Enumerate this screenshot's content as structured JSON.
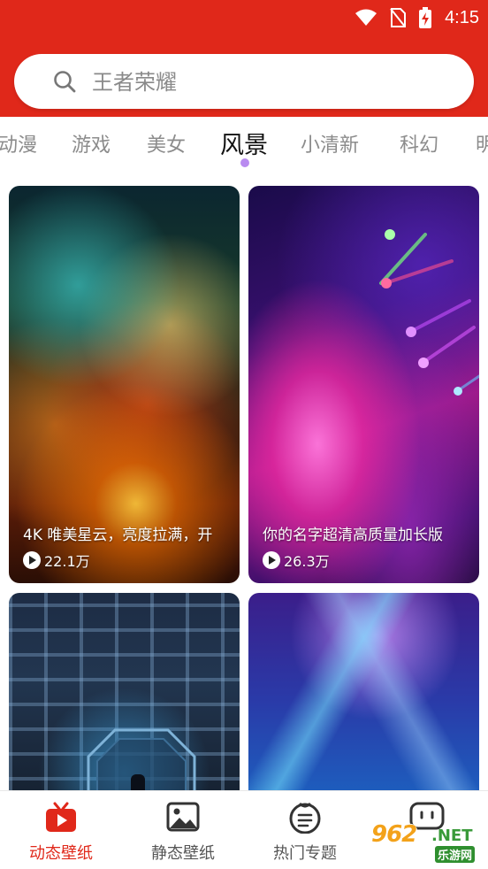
{
  "status_bar": {
    "time": "4:15"
  },
  "search": {
    "placeholder": "王者荣耀"
  },
  "tabs": [
    {
      "label": "动漫",
      "active": false
    },
    {
      "label": "游戏",
      "active": false
    },
    {
      "label": "美女",
      "active": false
    },
    {
      "label": "风景",
      "active": true
    },
    {
      "label": "小清新",
      "active": false
    },
    {
      "label": "科幻",
      "active": false
    },
    {
      "label": "明",
      "active": false
    }
  ],
  "cards": [
    {
      "title": "4K 唯美星云，亮度拉满，开",
      "views": "22.1万"
    },
    {
      "title": "你的名字超清高质量加长版",
      "views": "26.3万"
    },
    {
      "title": "",
      "views": ""
    },
    {
      "title": "",
      "views": ""
    }
  ],
  "bottom_nav": [
    {
      "label": "动态壁纸",
      "icon": "tv-play-icon",
      "active": true
    },
    {
      "label": "静态壁纸",
      "icon": "image-icon",
      "active": false
    },
    {
      "label": "热门专题",
      "icon": "list-smile-icon",
      "active": false
    },
    {
      "label": "",
      "icon": "chat-face-icon",
      "active": false
    }
  ],
  "watermark": {
    "brand": "962",
    "suffix": ".NET",
    "sub": "乐游网"
  },
  "colors": {
    "accent": "#e0281a",
    "tab_indicator": "#b98bf0"
  }
}
